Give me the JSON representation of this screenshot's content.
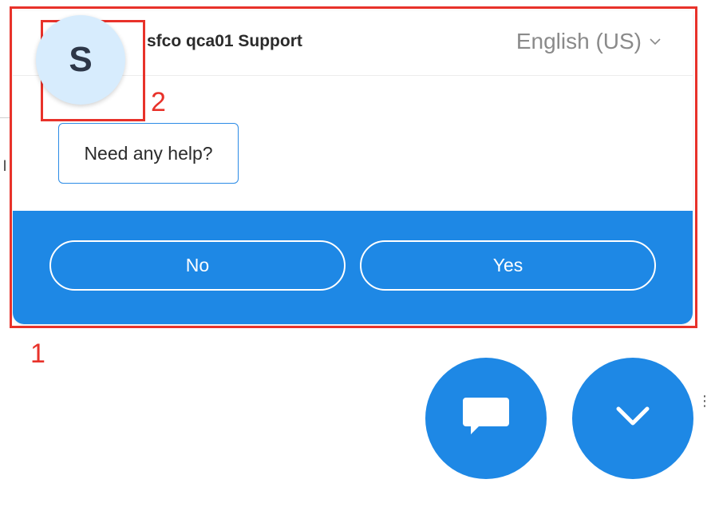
{
  "widget": {
    "avatar_letter": "S",
    "agent_name": "sfco qca01 Support",
    "language": "English (US)",
    "message": "Need any help?",
    "actions": {
      "no_label": "No",
      "yes_label": "Yes"
    },
    "accent_color": "#1e88e5",
    "avatar_bg_color": "#d7ecfd"
  },
  "fabs": {
    "chat_icon": "chat-bubble-icon",
    "minimize_icon": "chevron-down-icon"
  },
  "annotations": {
    "label_1": "1",
    "label_2": "2",
    "color": "#e8322a"
  },
  "page": {
    "glyph": "l",
    "edge_dots": "⋮"
  }
}
